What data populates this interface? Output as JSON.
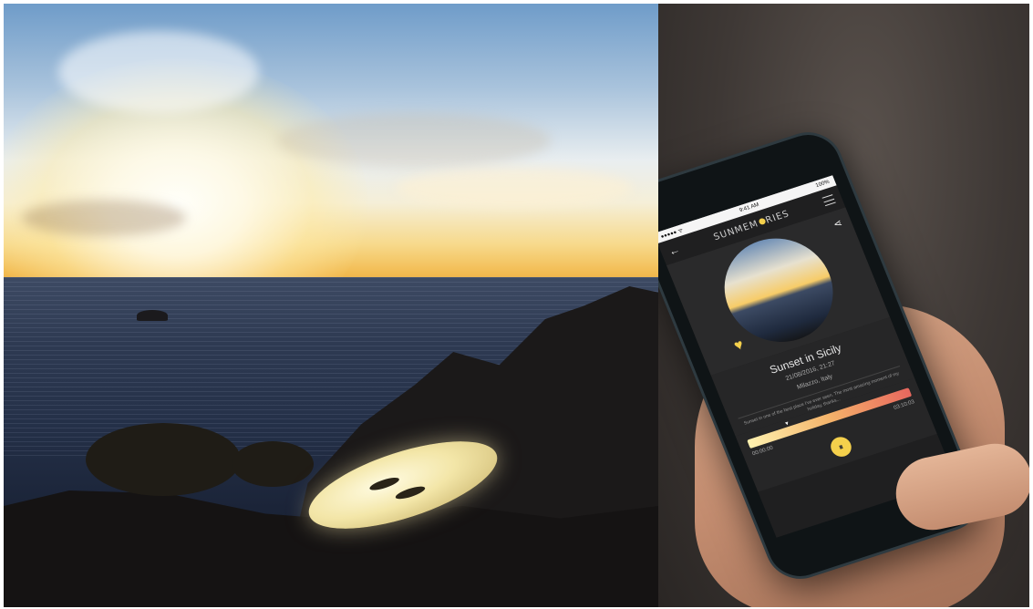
{
  "phone": {
    "status": {
      "carrier": "●●●●● ᯤ",
      "time": "9:41 AM",
      "battery": "100%"
    },
    "app": {
      "logo_prefix": "SUNMEM",
      "logo_suffix": "RIES"
    },
    "memory": {
      "title": "Sunset in Sicily",
      "datetime": "21/08/2016, 21:27",
      "location": "Milazzo, Italy",
      "description": "Sunset in one of the best place I've ever seen. The most amazing moment of my holiday, thanks..."
    },
    "player": {
      "elapsed": "00:00:00",
      "total": "03:10:03",
      "progress": 0.24
    }
  },
  "icons": {
    "back": "←",
    "share": "⋖",
    "heart": "♥",
    "pause": "⏸",
    "marker": "▼"
  },
  "colors": {
    "accent": "#f4d04c",
    "screen_bg": "#1f1f20"
  }
}
